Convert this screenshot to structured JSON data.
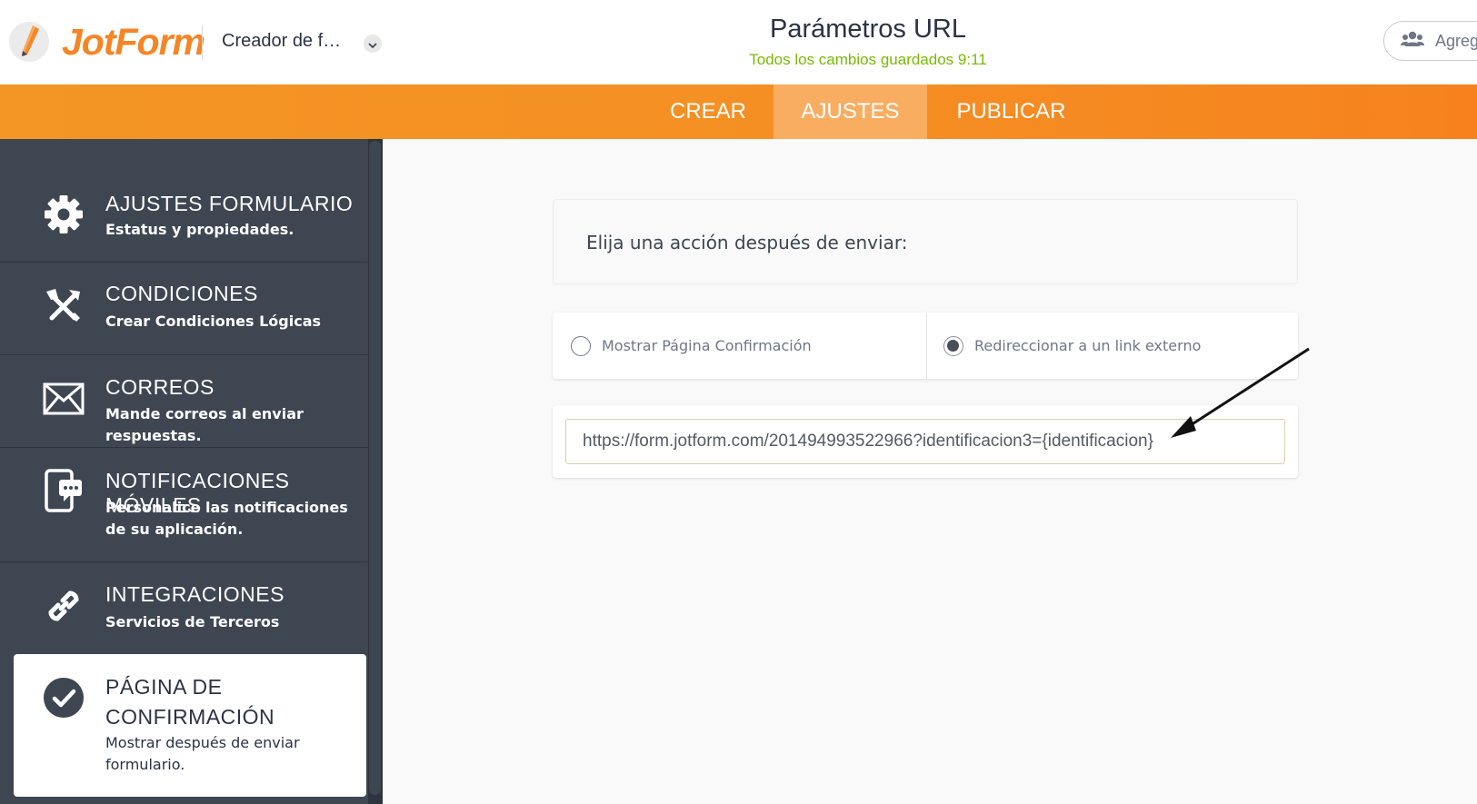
{
  "header": {
    "logo_text": "JotForm",
    "form_name": "Creador de f…",
    "page_title": "Parámetros URL",
    "save_status": "Todos los cambios guardados 9:11",
    "collab_label": "Agreg"
  },
  "nav": {
    "tabs": [
      {
        "label": "CREAR",
        "active": false
      },
      {
        "label": "AJUSTES",
        "active": true
      },
      {
        "label": "PUBLICAR",
        "active": false
      }
    ]
  },
  "sidebar": {
    "items": [
      {
        "title": "AJUSTES FORMULARIO",
        "desc": "Estatus y propiedades.",
        "icon": "gear-icon"
      },
      {
        "title": "CONDICIONES",
        "desc": "Crear Condiciones Lógicas",
        "icon": "tools-icon"
      },
      {
        "title": "CORREOS",
        "desc": "Mande correos al enviar respuestas.",
        "icon": "envelope-icon"
      },
      {
        "title": "NOTIFICACIONES MÓVILES",
        "desc": "Personalice las notificaciones de su aplicación.",
        "icon": "mobile-chat-icon"
      },
      {
        "title": "INTEGRACIONES",
        "desc": "Servicios de Terceros",
        "icon": "link-icon"
      },
      {
        "title": "PÁGINA DE CONFIRMACIÓN",
        "desc": "Mostrar después de enviar formulario.",
        "icon": "check-circle-icon",
        "active": true
      }
    ]
  },
  "main": {
    "action_label": "Elija una acción después de enviar:",
    "options": [
      {
        "label": "Mostrar Página Confirmación",
        "checked": false
      },
      {
        "label": "Redireccionar a un link externo",
        "checked": true
      }
    ],
    "redirect_url": "https://form.jotform.com/201494993522966?identificacion3={identificacion}"
  },
  "colors": {
    "brand_orange": "#f58525",
    "sidebar_bg": "#3e4652",
    "saved_green": "#78bb07",
    "active_tab": "#f9ad61"
  }
}
